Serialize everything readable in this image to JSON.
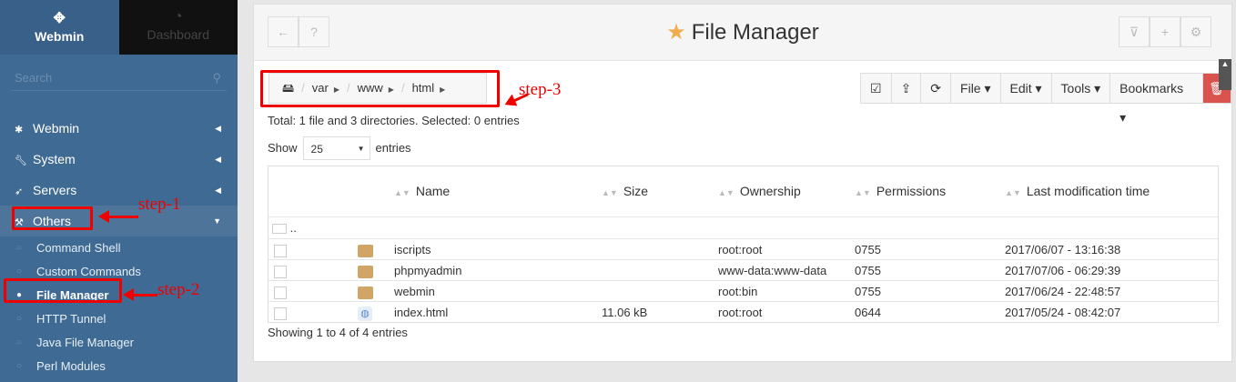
{
  "sidebar": {
    "tabs": {
      "webmin": "Webmin",
      "dashboard": "Dashboard"
    },
    "search_placeholder": "Search",
    "menu": [
      {
        "label": "Webmin"
      },
      {
        "label": "System"
      },
      {
        "label": "Servers"
      },
      {
        "label": "Others"
      }
    ],
    "submenu": [
      {
        "label": "Command Shell"
      },
      {
        "label": "Custom Commands"
      },
      {
        "label": "File Manager"
      },
      {
        "label": "HTTP Tunnel"
      },
      {
        "label": "Java File Manager"
      },
      {
        "label": "Perl Modules"
      }
    ]
  },
  "header": {
    "title": "File Manager"
  },
  "breadcrumb": [
    "var",
    "www",
    "html"
  ],
  "info": "Total: 1 file and 3 directories. Selected: 0 entries",
  "show": {
    "label": "Show",
    "value": "25",
    "suffix": "entries"
  },
  "toolbar": {
    "file": "File",
    "edit": "Edit",
    "tools": "Tools",
    "bookmarks": "Bookmarks"
  },
  "table": {
    "headers": {
      "name": "Name",
      "size": "Size",
      "ownership": "Ownership",
      "permissions": "Permissions",
      "modified": "Last modification time"
    },
    "up": "..",
    "rows": [
      {
        "name": "iscripts",
        "size": "",
        "owner": "root:root",
        "perm": "0755",
        "mtime": "2017/06/07 - 13:16:38"
      },
      {
        "name": "phpmyadmin",
        "size": "",
        "owner": "www-data:www-data",
        "perm": "0755",
        "mtime": "2017/07/06 - 06:29:39"
      },
      {
        "name": "webmin",
        "size": "",
        "owner": "root:bin",
        "perm": "0755",
        "mtime": "2017/06/24 - 22:48:57"
      },
      {
        "name": "index.html",
        "size": "11.06 kB",
        "owner": "root:root",
        "perm": "0644",
        "mtime": "2017/05/24 - 08:42:07"
      }
    ]
  },
  "footer": "Showing 1 to 4 of 4 entries",
  "annotations": {
    "step1": "step-1",
    "step2": "step-2",
    "step3": "step-3"
  },
  "colors": {
    "sidebar": "#3f6a93",
    "accent_star": "#f0ad4e",
    "delete": "#d9534f",
    "annotation": "#ee0000"
  }
}
